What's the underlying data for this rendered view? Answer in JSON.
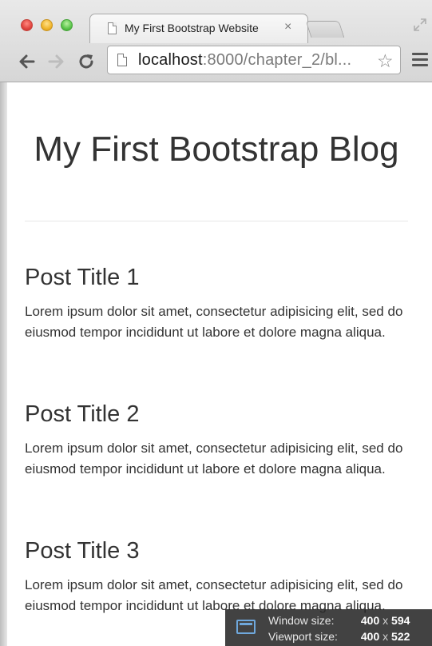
{
  "browser": {
    "tab_title": "My First Bootstrap Website",
    "tab_close": "×",
    "url_host": "localhost",
    "url_rest": ":8000/chapter_2/bl...",
    "star": "☆"
  },
  "page": {
    "header": "My First Bootstrap Blog",
    "posts": [
      {
        "title": "Post Title 1",
        "body": "Lorem ipsum dolor sit amet, consectetur adipisicing elit, sed do eiusmod tempor incididunt ut labore et dolore magna aliqua."
      },
      {
        "title": "Post Title 2",
        "body": "Lorem ipsum dolor sit amet, consectetur adipisicing elit, sed do eiusmod tempor incididunt ut labore et dolore magna aliqua."
      },
      {
        "title": "Post Title 3",
        "body": "Lorem ipsum dolor sit amet, consectetur adipisicing elit, sed do eiusmod tempor incididunt ut labore et dolore magna aliqua."
      }
    ]
  },
  "size_overlay": {
    "window_label": "Window size:",
    "window_w": "400",
    "window_h": "594",
    "viewport_label": "Viewport size:",
    "viewport_w": "400",
    "viewport_h": "522",
    "times": "x"
  },
  "icons": {
    "tab": "document-icon",
    "back": "back-arrow-icon",
    "forward": "forward-arrow-icon",
    "reload": "reload-icon",
    "page": "page-icon",
    "star": "star-icon",
    "menu": "hamburger-menu-icon",
    "fullscreen": "fullscreen-icon",
    "overlay": "window-resize-icon"
  },
  "colors": {
    "text": "#333333",
    "chrome": "#d6d6d6",
    "close": "#e0443e",
    "minimize": "#f0b52b",
    "maximize": "#5ac44a"
  }
}
